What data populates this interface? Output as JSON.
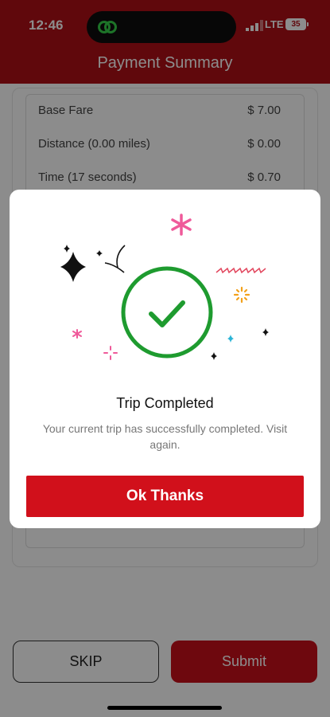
{
  "status_bar": {
    "time": "12:46",
    "network": "LTE",
    "battery": "35"
  },
  "header": {
    "title": "Payment Summary"
  },
  "fare": {
    "rows": [
      {
        "label": "Base Fare",
        "value": "$ 7.00"
      },
      {
        "label": "Distance (0.00 miles)",
        "value": "$ 0.00"
      },
      {
        "label": "Time (17 seconds)",
        "value": "$ 0.70"
      }
    ]
  },
  "actions": {
    "skip_label": "SKIP",
    "submit_label": "Submit"
  },
  "modal": {
    "title": "Trip Completed",
    "message": "Your current trip has successfully completed. Visit again.",
    "ok_label": "Ok Thanks",
    "success_color": "#1e9b2f"
  },
  "colors": {
    "brand": "#b01016",
    "button": "#d1101b"
  }
}
